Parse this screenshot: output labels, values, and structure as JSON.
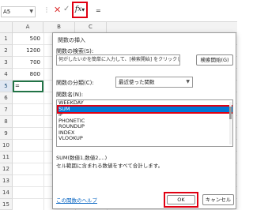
{
  "formula_bar": {
    "name_box": "A5",
    "fx_label": "fx",
    "formula": "="
  },
  "sheet": {
    "columns": [
      "A",
      "B",
      "C"
    ],
    "rows": [
      "1",
      "2",
      "3",
      "4",
      "5",
      "6",
      "7",
      "8",
      "9",
      "10",
      "11",
      "12",
      "13",
      "14",
      "15"
    ],
    "values": [
      "500",
      "1200",
      "700",
      "800"
    ],
    "active_cell_value": "="
  },
  "dialog": {
    "title": "関数の挿入",
    "search_label": "関数の検索(S):",
    "search_value": "何がしたいかを簡単に入力して、[検索開始] をクリックしてください。",
    "search_button": "検索開始(G)",
    "category_label": "関数の分類(C):",
    "category_value": "最近使った関数",
    "function_list_label": "関数名(N):",
    "functions": [
      "WEEKDAY",
      "SUM",
      "IF",
      "PHONETIC",
      "ROUNDUP",
      "INDEX",
      "VLOOKUP"
    ],
    "selected_function": "SUM",
    "syntax": "SUM(数値1,数値2,...)",
    "description": "セル範囲に含まれる数値をすべて合計します。",
    "help_link": "この関数のヘルプ",
    "ok_button": "OK",
    "cancel_button": "キャンセル"
  },
  "colors": {
    "highlight_red": "#e00012",
    "selection_blue": "#0078d7",
    "excel_green": "#217346"
  }
}
